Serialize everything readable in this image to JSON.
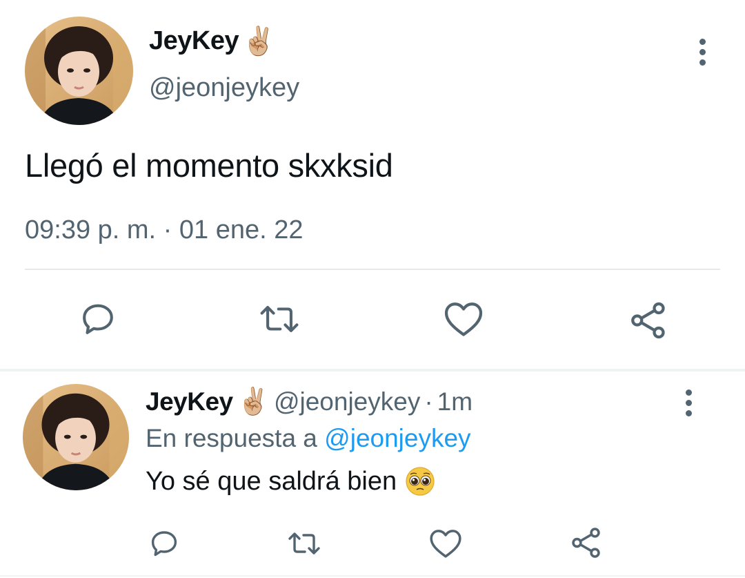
{
  "main_tweet": {
    "display_name": "JeyKey",
    "name_emoji": "✌🏼",
    "handle": "@jeonjeykey",
    "text": "Llegó el momento skxksid",
    "timestamp": "09:39 p. m. · 01 ene. 22",
    "actions": [
      "reply-icon",
      "retweet-icon",
      "like-icon",
      "share-icon"
    ]
  },
  "reply_tweet": {
    "display_name": "JeyKey",
    "name_emoji": "✌🏼",
    "handle": "@jeonjeykey",
    "separator": "·",
    "time": "1m",
    "reply_prefix": "En respuesta a",
    "reply_mention": "@jeonjeykey",
    "text": "Yo sé que saldrá bien",
    "text_emoji": "pleading-face",
    "actions": [
      "reply-icon",
      "retweet-icon",
      "like-icon",
      "share-icon"
    ]
  },
  "colors": {
    "text_primary": "#0f1419",
    "text_secondary": "#536471",
    "link": "#1d9bf0",
    "divider": "#e6e9eb"
  }
}
